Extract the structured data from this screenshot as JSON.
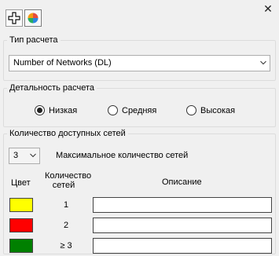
{
  "window": {
    "close_symbol": "✕"
  },
  "toolbar": {
    "buttons": [
      {
        "name": "add",
        "icon": "plus-icon"
      },
      {
        "name": "color-scheme",
        "icon": "color-wheel-icon"
      }
    ]
  },
  "calc_type": {
    "legend": "Тип расчета",
    "selected": "Number of Networks (DL)"
  },
  "detail": {
    "legend": "Детальность расчета",
    "options": [
      {
        "label": "Низкая",
        "selected": true
      },
      {
        "label": "Средняя",
        "selected": false
      },
      {
        "label": "Высокая",
        "selected": false
      }
    ]
  },
  "networks": {
    "legend": "Количество доступных сетей",
    "max_value": "3",
    "max_label": "Максимальное количество сетей",
    "headers": {
      "color": "Цвет",
      "count_line1": "Количество",
      "count_line2": "сетей",
      "description": "Описание"
    },
    "rows": [
      {
        "color": "#ffff00",
        "count": "1",
        "description": ""
      },
      {
        "color": "#ff0000",
        "count": "2",
        "description": ""
      },
      {
        "color": "#008000",
        "count": "≥  3",
        "description": ""
      }
    ]
  }
}
